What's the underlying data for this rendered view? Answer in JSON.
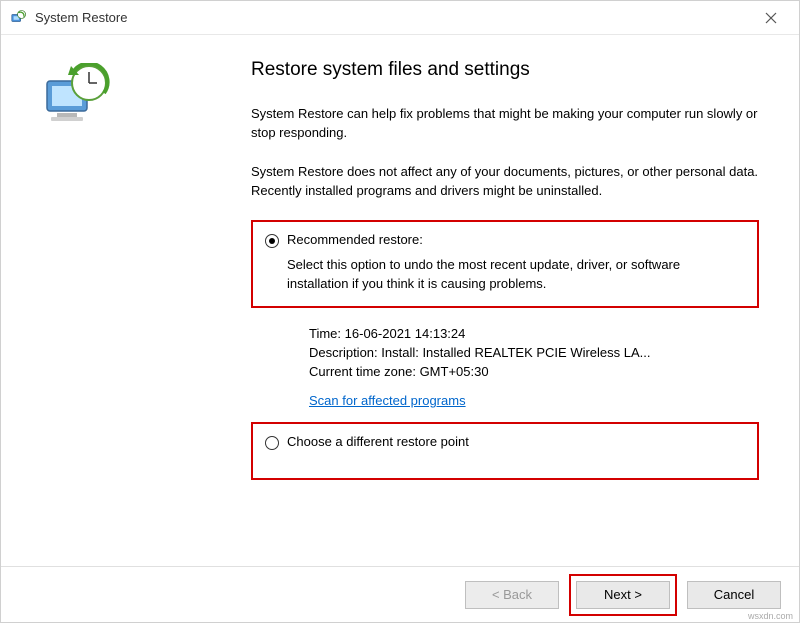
{
  "window": {
    "title": "System Restore"
  },
  "heading": "Restore system files and settings",
  "intro1": "System Restore can help fix problems that might be making your computer run slowly or stop responding.",
  "intro2": "System Restore does not affect any of your documents, pictures, or other personal data. Recently installed programs and drivers might be uninstalled.",
  "option_recommended": {
    "label": "Recommended restore:",
    "desc": "Select this option to undo the most recent update, driver, or software installation if you think it is causing problems."
  },
  "details": {
    "time_label": "Time:",
    "time_value": "16-06-2021 14:13:24",
    "desc_label": "Description:",
    "desc_value": "Install: Installed REALTEK PCIE Wireless LA...",
    "tz_label": "Current time zone:",
    "tz_value": "GMT+05:30"
  },
  "scan_link": "Scan for affected programs",
  "option_other": {
    "label": "Choose a different restore point"
  },
  "buttons": {
    "back": "< Back",
    "next": "Next >",
    "cancel": "Cancel"
  },
  "watermark": "wsxdn.com"
}
